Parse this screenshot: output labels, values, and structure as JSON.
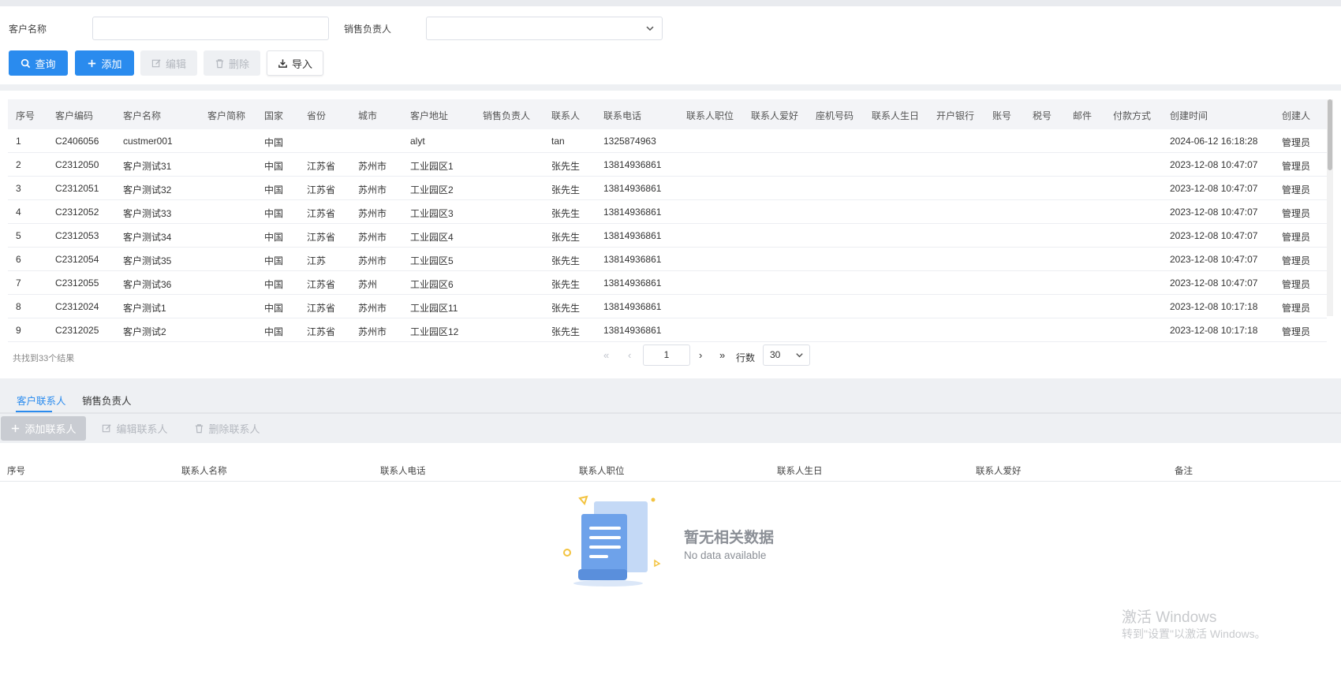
{
  "filters": {
    "customer_name_label": "客户名称",
    "customer_name_value": "",
    "sales_owner_label": "销售负责人",
    "sales_owner_value": ""
  },
  "toolbar": {
    "query": "查询",
    "add": "添加",
    "edit": "编辑",
    "delete": "删除",
    "import": "导入"
  },
  "table": {
    "columns": [
      "序号",
      "客户编码",
      "客户名称",
      "客户简称",
      "国家",
      "省份",
      "城市",
      "客户地址",
      "销售负责人",
      "联系人",
      "联系电话",
      "联系人职位",
      "联系人爱好",
      "座机号码",
      "联系人生日",
      "开户银行",
      "账号",
      "税号",
      "邮件",
      "付款方式",
      "创建时间",
      "创建人"
    ],
    "rows": [
      {
        "no": "1",
        "code": "C2406056",
        "name": "custmer001",
        "country": "中国",
        "province": "",
        "city": "",
        "address": "alyt",
        "contact": "tan",
        "phone": "1325874963",
        "created": "2024-06-12 16:18:28",
        "creator": "管理员"
      },
      {
        "no": "2",
        "code": "C2312050",
        "name": "客户测试31",
        "country": "中国",
        "province": "江苏省",
        "city": "苏州市",
        "address": "工业园区1",
        "contact": "张先生",
        "phone": "13814936861",
        "created": "2023-12-08 10:47:07",
        "creator": "管理员"
      },
      {
        "no": "3",
        "code": "C2312051",
        "name": "客户测试32",
        "country": "中国",
        "province": "江苏省",
        "city": "苏州市",
        "address": "工业园区2",
        "contact": "张先生",
        "phone": "13814936861",
        "created": "2023-12-08 10:47:07",
        "creator": "管理员"
      },
      {
        "no": "4",
        "code": "C2312052",
        "name": "客户测试33",
        "country": "中国",
        "province": "江苏省",
        "city": "苏州市",
        "address": "工业园区3",
        "contact": "张先生",
        "phone": "13814936861",
        "created": "2023-12-08 10:47:07",
        "creator": "管理员"
      },
      {
        "no": "5",
        "code": "C2312053",
        "name": "客户测试34",
        "country": "中国",
        "province": "江苏省",
        "city": "苏州市",
        "address": "工业园区4",
        "contact": "张先生",
        "phone": "13814936861",
        "created": "2023-12-08 10:47:07",
        "creator": "管理员"
      },
      {
        "no": "6",
        "code": "C2312054",
        "name": "客户测试35",
        "country": "中国",
        "province": "江苏",
        "city": "苏州市",
        "address": "工业园区5",
        "contact": "张先生",
        "phone": "13814936861",
        "created": "2023-12-08 10:47:07",
        "creator": "管理员"
      },
      {
        "no": "7",
        "code": "C2312055",
        "name": "客户测试36",
        "country": "中国",
        "province": "江苏省",
        "city": "苏州",
        "address": "工业园区6",
        "contact": "张先生",
        "phone": "13814936861",
        "created": "2023-12-08 10:47:07",
        "creator": "管理员"
      },
      {
        "no": "8",
        "code": "C2312024",
        "name": "客户测试1",
        "country": "中国",
        "province": "江苏省",
        "city": "苏州市",
        "address": "工业园区11",
        "contact": "张先生",
        "phone": "13814936861",
        "created": "2023-12-08 10:17:18",
        "creator": "管理员"
      },
      {
        "no": "9",
        "code": "C2312025",
        "name": "客户测试2",
        "country": "中国",
        "province": "江苏省",
        "city": "苏州市",
        "address": "工业园区12",
        "contact": "张先生",
        "phone": "13814936861",
        "created": "2023-12-08 10:17:18",
        "creator": "管理员"
      }
    ]
  },
  "pagination": {
    "summary": "共找到33个结果",
    "current_page": "1",
    "rows_label": "行数",
    "rows_per_page": "30"
  },
  "tabs": [
    "客户联系人",
    "销售负责人"
  ],
  "contact_toolbar": {
    "add": "添加联系人",
    "edit": "编辑联系人",
    "delete": "删除联系人"
  },
  "contact_table": {
    "columns": [
      "序号",
      "联系人名称",
      "联系人电话",
      "联系人职位",
      "联系人生日",
      "联系人爱好",
      "备注"
    ]
  },
  "empty_state": {
    "title": "暂无相关数据",
    "subtitle": "No data available"
  },
  "watermark": {
    "line1": "激活 Windows",
    "line2": "转到\"设置\"以激活 Windows。"
  }
}
